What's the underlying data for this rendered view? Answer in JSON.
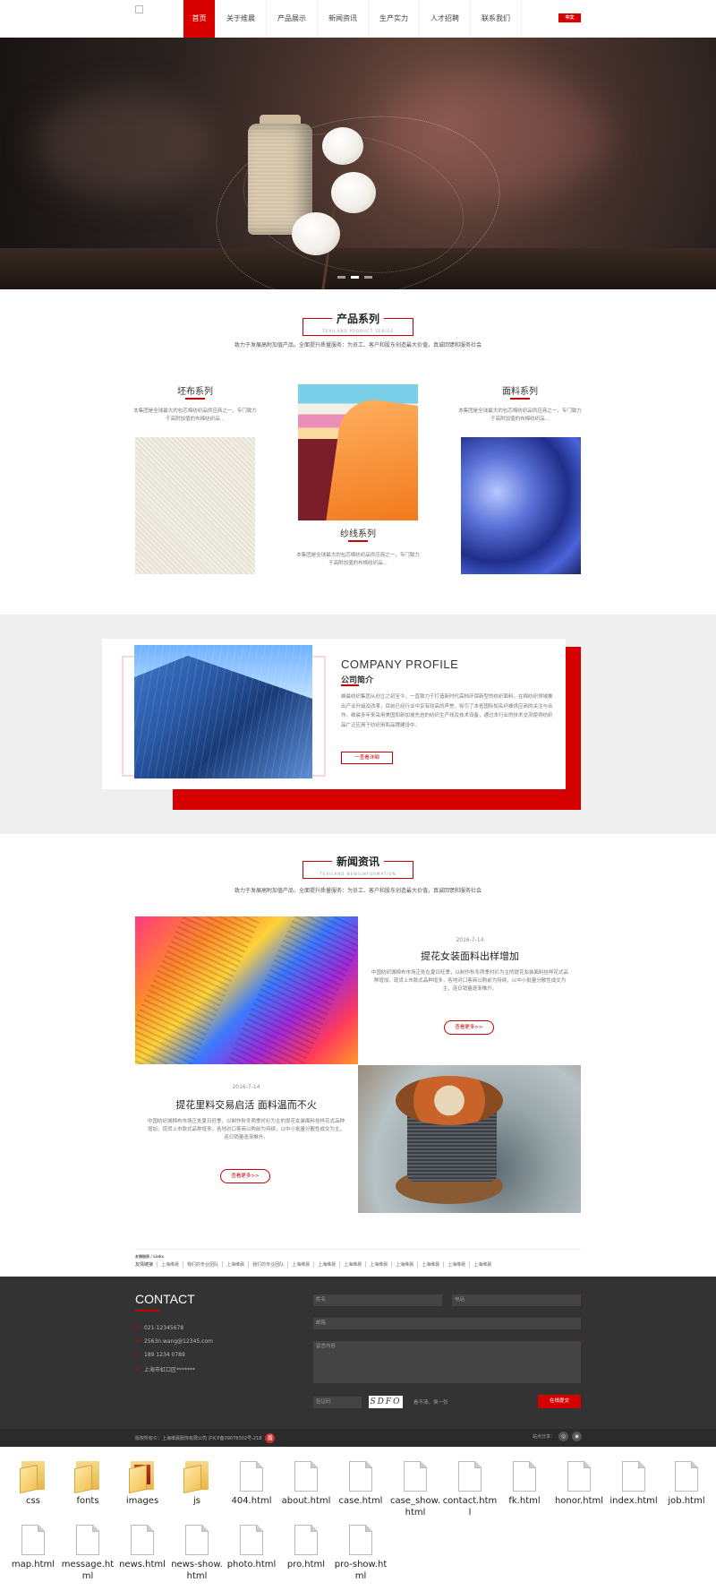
{
  "nav": {
    "items": [
      "首页",
      "关于维晨",
      "产品展示",
      "新闻资讯",
      "生产实力",
      "人才招聘",
      "联系我们"
    ],
    "lang": "中文"
  },
  "products": {
    "title": "产品系列",
    "title_en": "TEXILAND PRODUCT SERIES",
    "subtitle": "致力于发展高附加值产品，全面提升质量服务：为员工、客户和股东创造最大价值，真诚回馈和服务社会",
    "items": [
      {
        "name": "坯布系列",
        "desc": "本集团是全球最大的包芯棉纺织品供应商之一，专门致力于高附加值的布棉纺织品..."
      },
      {
        "name": "纱线系列",
        "desc": "本集团是全球最大的包芯棉纺织品供应商之一，专门致力于高附加值的布棉纺织品..."
      },
      {
        "name": "面料系列",
        "desc": "本集团是全球最大的包芯棉纺织品供应商之一，专门致力于高附加值的布棉纺织品..."
      }
    ]
  },
  "profile": {
    "title_en": "COMPANY PROFILE",
    "title_zh": "公司简介",
    "text": "维晨纺织集团从创立之初至今，一直致力于打造新时代高档环保新型的纺织面料，在棉纺织领域推出产业升级及改革，目前已经行业中享有较高的声誉，吸引了本省国际知名纤维供应商的关注与合作。维晨多年来采用美国和新加坡先进的纺织生产线及技术设备，通过本行业的技术交流使得纺织品广泛应用于纺织用和品牌建设中。",
    "button": "一查看详细"
  },
  "news": {
    "title": "新闻资讯",
    "title_en": "TEXILAND NEWSINFORMATION",
    "subtitle": "致力于发展高附加值产品，全面提升质量服务：为员工、客户和股东创造最大价值，真诚回馈和服务社会",
    "items": [
      {
        "date": "2016-7-14",
        "title": "提花女装面料出样增加",
        "desc": "中国纺织城棉布市场正处在夏日旺季，以制作秋冬两季衬衫为主的提花女装面料挂样花式品种增加，现货上市款式品种增多，各地对口客商以购前为持续，以中小批量分散性成交为主，连日销量逐渐推升。",
        "button": "查看更多>>"
      },
      {
        "date": "2016-7-14",
        "title": "提花里料交易启活 面料温而不火",
        "desc": "中国纺织城棉布市场正处夏日旺季，以制作秋冬两季衬衫为主的提花女装面料挂样花式品种增加，现货上市款式品种增多，各地对口客商以购前为持续，以中小批量分散性成交为主，连日销量逐渐推升。",
        "button": "查看更多>>"
      }
    ]
  },
  "friend_links": {
    "head": "友情链接 / Links",
    "label": "友情链接",
    "items": [
      "上海维晨",
      "我们的专业团队",
      "上海维晨",
      "我们的专业团队",
      "上海维晨",
      "上海维晨",
      "上海维晨",
      "上海维晨",
      "上海维晨",
      "上海维晨",
      "上海维晨",
      "上海维晨",
      "上海维晨"
    ]
  },
  "contact": {
    "title": "CONTACT",
    "phone": "021-12345678",
    "email": "2563n.wang@12345.com",
    "mobile": "189 1234 0789",
    "address": "上海市虹口区*******",
    "form": {
      "name": "姓名",
      "tel": "电话",
      "email": "邮箱",
      "message": "留言内容",
      "captcha": "验证码",
      "captcha_code": "SDFO",
      "captcha_refresh": "看不清，换一张",
      "submit": "在线提交"
    },
    "copyright": "版权所有©：上海维晨服饰有限公司 沪ICP备09078302号-218",
    "share_label": "站点分享："
  },
  "explorer": {
    "files": [
      {
        "name": "css",
        "kind": "folder"
      },
      {
        "name": "fonts",
        "kind": "folder"
      },
      {
        "name": "images",
        "kind": "folder-image"
      },
      {
        "name": "js",
        "kind": "folder"
      },
      {
        "name": "404.html",
        "kind": "file"
      },
      {
        "name": "about.html",
        "kind": "file"
      },
      {
        "name": "case.html",
        "kind": "file"
      },
      {
        "name": "case_show.html",
        "kind": "file"
      },
      {
        "name": "contact.html",
        "kind": "file"
      },
      {
        "name": "fk.html",
        "kind": "file"
      },
      {
        "name": "honor.html",
        "kind": "file"
      },
      {
        "name": "index.html",
        "kind": "file"
      },
      {
        "name": "job.html",
        "kind": "file"
      },
      {
        "name": "map.html",
        "kind": "file"
      },
      {
        "name": "message.html",
        "kind": "file"
      },
      {
        "name": "news.html",
        "kind": "file"
      },
      {
        "name": "news-show.html",
        "kind": "file"
      },
      {
        "name": "photo.html",
        "kind": "file"
      },
      {
        "name": "pro.html",
        "kind": "file"
      },
      {
        "name": "pro-show.html",
        "kind": "file"
      }
    ]
  },
  "colors": {
    "accent": "#d90000",
    "footer": "#333333"
  }
}
